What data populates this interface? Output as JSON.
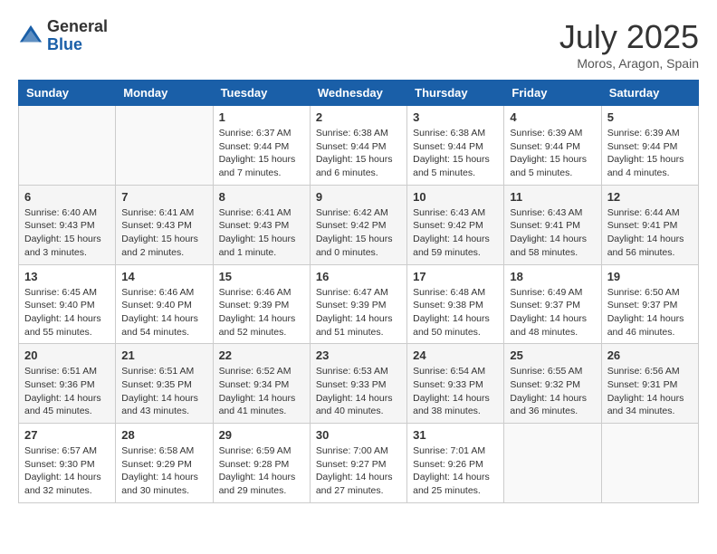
{
  "header": {
    "logo_general": "General",
    "logo_blue": "Blue",
    "month_title": "July 2025",
    "location": "Moros, Aragon, Spain"
  },
  "weekdays": [
    "Sunday",
    "Monday",
    "Tuesday",
    "Wednesday",
    "Thursday",
    "Friday",
    "Saturday"
  ],
  "weeks": [
    [
      {
        "day": "",
        "info": ""
      },
      {
        "day": "",
        "info": ""
      },
      {
        "day": "1",
        "info": "Sunrise: 6:37 AM\nSunset: 9:44 PM\nDaylight: 15 hours and 7 minutes."
      },
      {
        "day": "2",
        "info": "Sunrise: 6:38 AM\nSunset: 9:44 PM\nDaylight: 15 hours and 6 minutes."
      },
      {
        "day": "3",
        "info": "Sunrise: 6:38 AM\nSunset: 9:44 PM\nDaylight: 15 hours and 5 minutes."
      },
      {
        "day": "4",
        "info": "Sunrise: 6:39 AM\nSunset: 9:44 PM\nDaylight: 15 hours and 5 minutes."
      },
      {
        "day": "5",
        "info": "Sunrise: 6:39 AM\nSunset: 9:44 PM\nDaylight: 15 hours and 4 minutes."
      }
    ],
    [
      {
        "day": "6",
        "info": "Sunrise: 6:40 AM\nSunset: 9:43 PM\nDaylight: 15 hours and 3 minutes."
      },
      {
        "day": "7",
        "info": "Sunrise: 6:41 AM\nSunset: 9:43 PM\nDaylight: 15 hours and 2 minutes."
      },
      {
        "day": "8",
        "info": "Sunrise: 6:41 AM\nSunset: 9:43 PM\nDaylight: 15 hours and 1 minute."
      },
      {
        "day": "9",
        "info": "Sunrise: 6:42 AM\nSunset: 9:42 PM\nDaylight: 15 hours and 0 minutes."
      },
      {
        "day": "10",
        "info": "Sunrise: 6:43 AM\nSunset: 9:42 PM\nDaylight: 14 hours and 59 minutes."
      },
      {
        "day": "11",
        "info": "Sunrise: 6:43 AM\nSunset: 9:41 PM\nDaylight: 14 hours and 58 minutes."
      },
      {
        "day": "12",
        "info": "Sunrise: 6:44 AM\nSunset: 9:41 PM\nDaylight: 14 hours and 56 minutes."
      }
    ],
    [
      {
        "day": "13",
        "info": "Sunrise: 6:45 AM\nSunset: 9:40 PM\nDaylight: 14 hours and 55 minutes."
      },
      {
        "day": "14",
        "info": "Sunrise: 6:46 AM\nSunset: 9:40 PM\nDaylight: 14 hours and 54 minutes."
      },
      {
        "day": "15",
        "info": "Sunrise: 6:46 AM\nSunset: 9:39 PM\nDaylight: 14 hours and 52 minutes."
      },
      {
        "day": "16",
        "info": "Sunrise: 6:47 AM\nSunset: 9:39 PM\nDaylight: 14 hours and 51 minutes."
      },
      {
        "day": "17",
        "info": "Sunrise: 6:48 AM\nSunset: 9:38 PM\nDaylight: 14 hours and 50 minutes."
      },
      {
        "day": "18",
        "info": "Sunrise: 6:49 AM\nSunset: 9:37 PM\nDaylight: 14 hours and 48 minutes."
      },
      {
        "day": "19",
        "info": "Sunrise: 6:50 AM\nSunset: 9:37 PM\nDaylight: 14 hours and 46 minutes."
      }
    ],
    [
      {
        "day": "20",
        "info": "Sunrise: 6:51 AM\nSunset: 9:36 PM\nDaylight: 14 hours and 45 minutes."
      },
      {
        "day": "21",
        "info": "Sunrise: 6:51 AM\nSunset: 9:35 PM\nDaylight: 14 hours and 43 minutes."
      },
      {
        "day": "22",
        "info": "Sunrise: 6:52 AM\nSunset: 9:34 PM\nDaylight: 14 hours and 41 minutes."
      },
      {
        "day": "23",
        "info": "Sunrise: 6:53 AM\nSunset: 9:33 PM\nDaylight: 14 hours and 40 minutes."
      },
      {
        "day": "24",
        "info": "Sunrise: 6:54 AM\nSunset: 9:33 PM\nDaylight: 14 hours and 38 minutes."
      },
      {
        "day": "25",
        "info": "Sunrise: 6:55 AM\nSunset: 9:32 PM\nDaylight: 14 hours and 36 minutes."
      },
      {
        "day": "26",
        "info": "Sunrise: 6:56 AM\nSunset: 9:31 PM\nDaylight: 14 hours and 34 minutes."
      }
    ],
    [
      {
        "day": "27",
        "info": "Sunrise: 6:57 AM\nSunset: 9:30 PM\nDaylight: 14 hours and 32 minutes."
      },
      {
        "day": "28",
        "info": "Sunrise: 6:58 AM\nSunset: 9:29 PM\nDaylight: 14 hours and 30 minutes."
      },
      {
        "day": "29",
        "info": "Sunrise: 6:59 AM\nSunset: 9:28 PM\nDaylight: 14 hours and 29 minutes."
      },
      {
        "day": "30",
        "info": "Sunrise: 7:00 AM\nSunset: 9:27 PM\nDaylight: 14 hours and 27 minutes."
      },
      {
        "day": "31",
        "info": "Sunrise: 7:01 AM\nSunset: 9:26 PM\nDaylight: 14 hours and 25 minutes."
      },
      {
        "day": "",
        "info": ""
      },
      {
        "day": "",
        "info": ""
      }
    ]
  ]
}
